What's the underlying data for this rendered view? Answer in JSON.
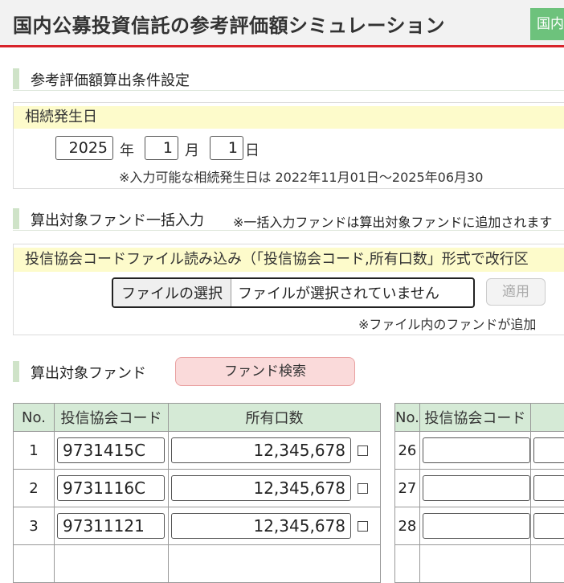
{
  "header": {
    "title": "国内公募投資信託の参考評価額シミュレーション",
    "right_button": "国内"
  },
  "section1": {
    "title": "参考評価額算出条件設定",
    "panel_label": "相続発生日",
    "year": "2025",
    "year_unit": "年",
    "month": "1",
    "month_unit": "月",
    "day": "1",
    "day_unit": "日",
    "note": "※入力可能な相続発生日は 2022年11月01日～2025年06月30"
  },
  "section2": {
    "title": "算出対象ファンド一括入力",
    "note": "※一括入力ファンドは算出対象ファンドに追加されます",
    "panel_label": "投信協会コードファイル読み込み（「投信協会コード,所有口数」形式で改行区",
    "file_button": "ファイルの選択",
    "file_status": "ファイルが選択されていません",
    "apply_button": "適用",
    "footnote": "※ファイル内のファンドが追加"
  },
  "section3": {
    "title": "算出対象ファンド",
    "search_button": "ファンド検索"
  },
  "table_left": {
    "headers": {
      "no": "No.",
      "code": "投信協会コード",
      "qty": "所有口数"
    },
    "rows": [
      {
        "no": "1",
        "code": "9731415C",
        "qty": "12,345,678"
      },
      {
        "no": "2",
        "code": "9731116C",
        "qty": "12,345,678"
      },
      {
        "no": "3",
        "code": "97311121",
        "qty": "12,345,678"
      }
    ]
  },
  "table_right": {
    "headers": {
      "no": "No.",
      "code": "投信協会コード"
    },
    "rows": [
      {
        "no": "26",
        "code": ""
      },
      {
        "no": "27",
        "code": ""
      },
      {
        "no": "28",
        "code": ""
      }
    ]
  },
  "colors": {
    "header_accent": "#d8232a",
    "header_button": "#6dc27c",
    "section_bar": "#cfe3c8",
    "panel_head_bg": "#fdfbcb",
    "table_head_bg": "#d5ead6",
    "search_button_bg": "#fadada"
  }
}
